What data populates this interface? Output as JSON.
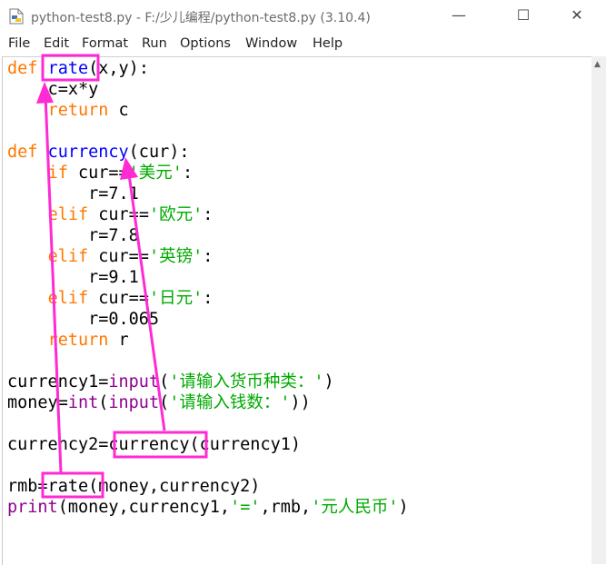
{
  "window": {
    "title": "python-test8.py - F:/少儿编程/python-test8.py (3.10.4)",
    "minimize": "—",
    "maximize": "☐",
    "close": "✕"
  },
  "menu": [
    "File",
    "Edit",
    "Format",
    "Run",
    "Options",
    "Window",
    "Help"
  ],
  "code": {
    "l1": {
      "def": "def",
      "name": "rate",
      "rest": "(x,y):"
    },
    "l2": {
      "text": "c=x*y"
    },
    "l3": {
      "kw": "return",
      "rest": " c"
    },
    "l5": {
      "def": "def",
      "name": "currency",
      "rest": "(cur):"
    },
    "l6": {
      "kw": "if",
      "a": " cur==",
      "s": "'美元'",
      "b": ":"
    },
    "l7": {
      "text": "r=7.1"
    },
    "l8": {
      "kw": "elif",
      "a": " cur==",
      "s": "'欧元'",
      "b": ":"
    },
    "l9": {
      "text": "r=7.8"
    },
    "l10": {
      "kw": "elif",
      "a": " cur==",
      "s": "'英镑'",
      "b": ":"
    },
    "l11": {
      "text": "r=9.1"
    },
    "l12": {
      "kw": "elif",
      "a": " cur==",
      "s": "'日元'",
      "b": ":"
    },
    "l13": {
      "text": "r=0.065"
    },
    "l14": {
      "kw": "return",
      "rest": " r"
    },
    "l16": {
      "a": "currency1=",
      "bi": "input",
      "b": "(",
      "s": "'请输入货币种类：'",
      "c": ")"
    },
    "l17": {
      "a": "money=",
      "bi1": "int",
      "b": "(",
      "bi2": "input",
      "c": "(",
      "s": "'请输入钱数：'",
      "d": "))"
    },
    "l19": {
      "text": "currency2=currency(currency1)"
    },
    "l21": {
      "text": "rmb=rate(money,currency2)"
    },
    "l22": {
      "bi": "print",
      "a": "(money,currency1,",
      "s1": "'='",
      "b": ",rmb,",
      "s2": "'元人民币'",
      "c": ")"
    }
  },
  "colors": {
    "keyword": "#ff7700",
    "function_name": "#0000ff",
    "builtin": "#900090",
    "string": "#00aa00",
    "annotation": "#ff2ad4"
  }
}
